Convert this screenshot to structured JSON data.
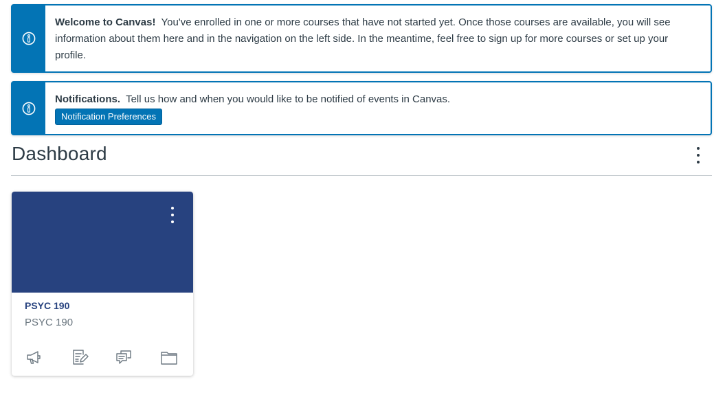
{
  "alerts": {
    "welcome": {
      "title": "Welcome to Canvas!",
      "message": "You've enrolled in one or more courses that have not started yet. Once those courses are available, you will see information about them here and in the navigation on the left side. In the meantime, feel free to sign up for more courses or set up your profile.",
      "icon": "info-icon"
    },
    "notifications": {
      "title": "Notifications.",
      "message": "Tell us how and when you would like to be notified of events in Canvas.",
      "button_label": "Notification Preferences",
      "icon": "info-icon"
    }
  },
  "dashboard": {
    "title": "Dashboard",
    "options_icon": "kebab-menu-icon"
  },
  "course_card": {
    "code": "PSYC 190",
    "name": "PSYC 190",
    "color": "#27427f",
    "options_icon": "kebab-menu-icon",
    "actions": [
      {
        "icon": "announcements-icon"
      },
      {
        "icon": "assignments-icon"
      },
      {
        "icon": "discussions-icon"
      },
      {
        "icon": "files-icon"
      }
    ]
  },
  "colors": {
    "brand": "#0374b5",
    "text": "#2d3b45",
    "muted": "#6b7780",
    "course": "#27427f"
  }
}
